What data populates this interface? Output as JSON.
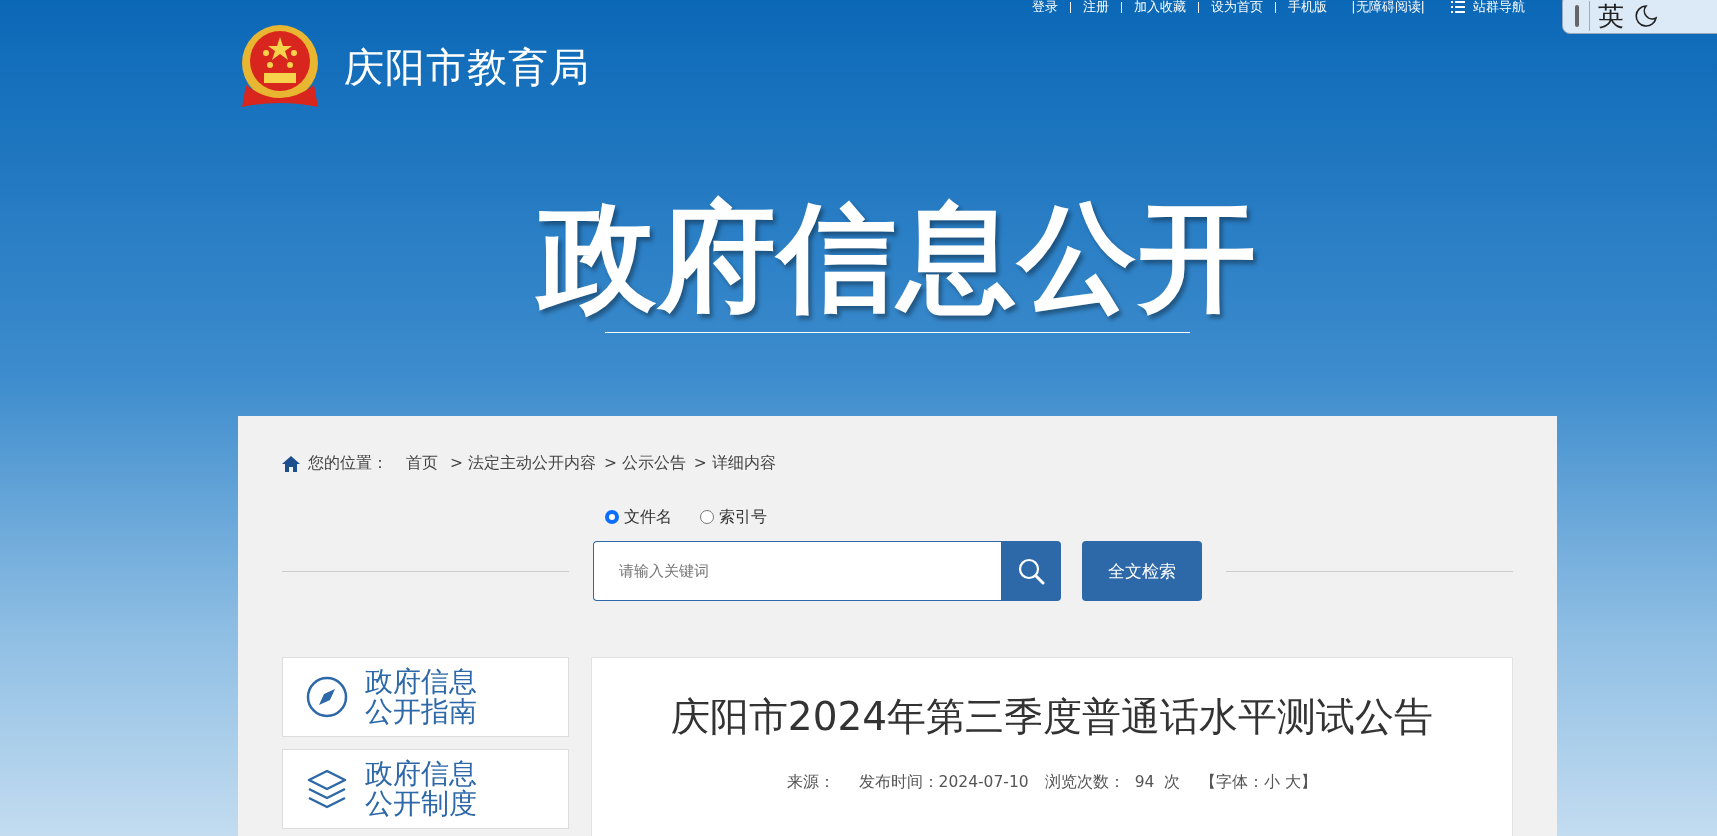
{
  "top_links": [
    {
      "label": "登录"
    },
    {
      "label": "注册"
    },
    {
      "label": "加入收藏"
    },
    {
      "label": "设为首页"
    },
    {
      "label": "手机版"
    },
    {
      "label": "|无障碍阅读|"
    }
  ],
  "site_nav": "站群导航",
  "ime": {
    "label": "英"
  },
  "header": {
    "site_title": "庆阳市教育局"
  },
  "banner_title": "政府信息公开",
  "breadcrumb": {
    "label": "您的位置：",
    "items": [
      "首页",
      "> 法定主动公开内容",
      "> 公示公告",
      "> 详细内容"
    ]
  },
  "search": {
    "options": [
      {
        "label": "文件名",
        "selected": true
      },
      {
        "label": "索引号",
        "selected": false
      }
    ],
    "placeholder": "请输入关键词",
    "fulltext_button": "全文检索"
  },
  "sidebar": {
    "items": [
      {
        "kind": "compass",
        "line1": "政府信息",
        "line2": "公开指南"
      },
      {
        "kind": "layers",
        "line1": "政府信息",
        "line2": "公开制度"
      }
    ]
  },
  "article": {
    "title": "庆阳市2024年第三季度普通话水平测试公告",
    "meta": {
      "source_label": "来源：",
      "date_label": "发布时间：",
      "date": "2024-07-10",
      "views_label": "浏览次数：",
      "views": "94",
      "views_unit": "次",
      "font_open": "【字体：",
      "font_small": "小",
      "font_large": "大",
      "font_close": "】"
    }
  }
}
